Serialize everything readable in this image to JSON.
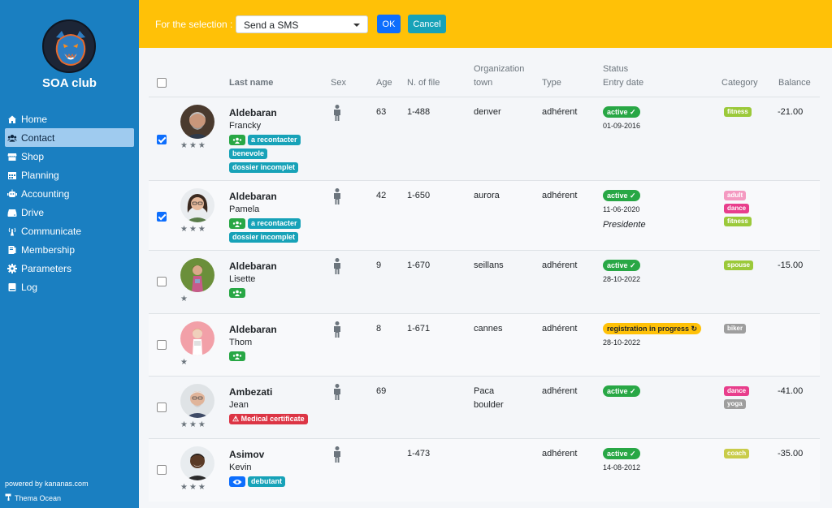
{
  "sidebar": {
    "club_name": "SOA club",
    "items": [
      {
        "label": "Home",
        "icon": "home-icon"
      },
      {
        "label": "Contact",
        "icon": "users-icon",
        "active": true
      },
      {
        "label": "Shop",
        "icon": "store-icon"
      },
      {
        "label": "Planning",
        "icon": "calendar-icon"
      },
      {
        "label": "Accounting",
        "icon": "robot-icon"
      },
      {
        "label": "Drive",
        "icon": "hdd-icon"
      },
      {
        "label": "Communicate",
        "icon": "broadcast-icon"
      },
      {
        "label": "Membership",
        "icon": "id-card-icon"
      },
      {
        "label": "Parameters",
        "icon": "gear-icon"
      },
      {
        "label": "Log",
        "icon": "book-icon"
      }
    ],
    "powered_by": "powered by kananas.com",
    "theme": "Thema Ocean"
  },
  "topbar": {
    "selection_label": "For the selection :",
    "selected_action": "Send a SMS",
    "ok_label": "OK",
    "cancel_label": "Cancel"
  },
  "table": {
    "headers": {
      "last_name": "Last name",
      "sex": "Sex",
      "age": "Age",
      "file_no": "N. of file",
      "org": "Organization",
      "town": "town",
      "type": "Type",
      "status": "Status",
      "entry": "Entry date",
      "category": "Category",
      "balance": "Balance"
    },
    "rows": [
      {
        "last": "Aldebaran",
        "first": "Francky",
        "stars": "★★★",
        "checked": true,
        "age": "63",
        "file": "1-488",
        "town": "denver",
        "type": "adhérent",
        "status": "active",
        "entry": "01-09-2016",
        "tags": [
          "a recontacter",
          "benevole",
          "dossier incomplet"
        ],
        "cats": [
          "fitness"
        ],
        "balance": "-21.00"
      },
      {
        "last": "Aldebaran",
        "first": "Pamela",
        "stars": "★★★",
        "checked": true,
        "age": "42",
        "file": "1-650",
        "town": "aurora",
        "type": "adhérent",
        "status": "active",
        "entry": "11-06-2020",
        "role": "Presidente",
        "tags": [
          "a recontacter",
          "dossier incomplet"
        ],
        "cats": [
          "adult",
          "dance",
          "fitness"
        ],
        "balance": ""
      },
      {
        "last": "Aldebaran",
        "first": "Lisette",
        "stars": "★",
        "checked": false,
        "age": "9",
        "file": "1-670",
        "town": "seillans",
        "type": "adhérent",
        "status": "active",
        "entry": "28-10-2022",
        "tags": [],
        "cats": [
          "spouse"
        ],
        "balance": "-15.00"
      },
      {
        "last": "Aldebaran",
        "first": "Thom",
        "stars": "★",
        "checked": false,
        "age": "8",
        "file": "1-671",
        "town": "cannes",
        "type": "adhérent",
        "status": "registration in progress",
        "entry": "28-10-2022",
        "tags": [],
        "cats": [
          "biker"
        ],
        "balance": ""
      },
      {
        "last": "Ambezati",
        "first": "Jean",
        "stars": "★★★",
        "checked": false,
        "age": "69",
        "file": "",
        "town": "Paca",
        "town2": "boulder",
        "type": "adhérent",
        "status": "active",
        "entry": "",
        "tags": [
          "Medical certificate"
        ],
        "cats": [
          "dance",
          "yoga"
        ],
        "balance": "-41.00"
      },
      {
        "last": "Asimov",
        "first": "Kevin",
        "stars": "★★★",
        "checked": false,
        "age": "",
        "file": "1-473",
        "town": "",
        "type": "adhérent",
        "status": "active",
        "entry": "14-08-2012",
        "tags": [
          "debutant"
        ],
        "cats": [
          "coach"
        ],
        "balance": "-35.00"
      }
    ]
  },
  "colors": {
    "sidebar": "#1a7fc1",
    "topbar": "#ffc107",
    "fitness": "#9bc93a",
    "adult": "#f49ac1",
    "dance": "#e83e8c",
    "spouse": "#9bc93a",
    "biker": "#9e9e9e",
    "yoga": "#9e9e9e",
    "coach": "#c9cc4a"
  }
}
